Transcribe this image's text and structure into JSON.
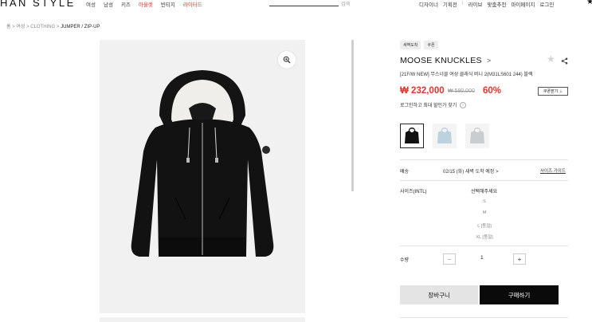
{
  "header": {
    "logo": "HAN STYLE",
    "nav": [
      "여성",
      "남성",
      "키즈",
      "아울렛",
      "빈티지",
      "라이터드"
    ],
    "search_label": "검색",
    "util": [
      "디자이너",
      "기획전",
      "|",
      "라이브",
      "맞춤추천",
      "마이페이지",
      "로그인"
    ]
  },
  "breadcrumb": {
    "path": "홈 > 여성 > CLOTHING > ",
    "current": "JUMPER / ZIP-UP"
  },
  "product": {
    "tags": [
      "새벽도착",
      "쿠폰"
    ],
    "brand": "MOOSE KNUCKLES",
    "brand_chevron": ">",
    "name": "[21F/W NEW] 무스너클 여성 클래식 버니 2(M31LS601 244) 블랙",
    "price": "₩ 232,000",
    "original_price": "₩ 580,000",
    "discount": "60%",
    "coupon_label": "쿠폰받기 ⊥",
    "login_sale": "로그인하고 최대 할인가 찾기",
    "login_sale_icon": "›"
  },
  "shipping": {
    "label": "배송",
    "info": "02/15 (화) 새벽 도착 예정 >",
    "size_guide": "사이즈 가이드"
  },
  "size": {
    "label": "사이즈(INTL)",
    "placeholder": "선택해주세요",
    "options": [
      "S",
      "M",
      "L [품절]",
      "XL [품절]"
    ]
  },
  "quantity": {
    "label": "수량",
    "minus": "−",
    "value": "1",
    "plus": "+"
  },
  "actions": {
    "cart": "장바구니",
    "buy": "구매하기"
  },
  "colors": {
    "accent": "#e8322e",
    "buy_bg": "#0a0a0a",
    "cart_bg": "#e4e4e4"
  }
}
